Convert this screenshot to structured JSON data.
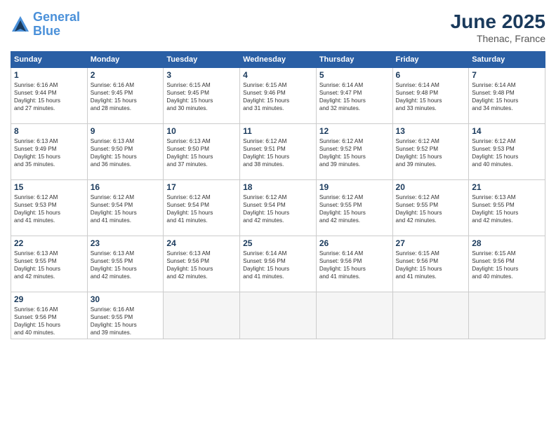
{
  "header": {
    "logo_line1": "General",
    "logo_line2": "Blue",
    "month": "June 2025",
    "location": "Thenac, France"
  },
  "weekdays": [
    "Sunday",
    "Monday",
    "Tuesday",
    "Wednesday",
    "Thursday",
    "Friday",
    "Saturday"
  ],
  "weeks": [
    [
      {
        "day": "1",
        "info": "Sunrise: 6:16 AM\nSunset: 9:44 PM\nDaylight: 15 hours\nand 27 minutes."
      },
      {
        "day": "2",
        "info": "Sunrise: 6:16 AM\nSunset: 9:45 PM\nDaylight: 15 hours\nand 28 minutes."
      },
      {
        "day": "3",
        "info": "Sunrise: 6:15 AM\nSunset: 9:45 PM\nDaylight: 15 hours\nand 30 minutes."
      },
      {
        "day": "4",
        "info": "Sunrise: 6:15 AM\nSunset: 9:46 PM\nDaylight: 15 hours\nand 31 minutes."
      },
      {
        "day": "5",
        "info": "Sunrise: 6:14 AM\nSunset: 9:47 PM\nDaylight: 15 hours\nand 32 minutes."
      },
      {
        "day": "6",
        "info": "Sunrise: 6:14 AM\nSunset: 9:48 PM\nDaylight: 15 hours\nand 33 minutes."
      },
      {
        "day": "7",
        "info": "Sunrise: 6:14 AM\nSunset: 9:48 PM\nDaylight: 15 hours\nand 34 minutes."
      }
    ],
    [
      {
        "day": "8",
        "info": "Sunrise: 6:13 AM\nSunset: 9:49 PM\nDaylight: 15 hours\nand 35 minutes."
      },
      {
        "day": "9",
        "info": "Sunrise: 6:13 AM\nSunset: 9:50 PM\nDaylight: 15 hours\nand 36 minutes."
      },
      {
        "day": "10",
        "info": "Sunrise: 6:13 AM\nSunset: 9:50 PM\nDaylight: 15 hours\nand 37 minutes."
      },
      {
        "day": "11",
        "info": "Sunrise: 6:12 AM\nSunset: 9:51 PM\nDaylight: 15 hours\nand 38 minutes."
      },
      {
        "day": "12",
        "info": "Sunrise: 6:12 AM\nSunset: 9:52 PM\nDaylight: 15 hours\nand 39 minutes."
      },
      {
        "day": "13",
        "info": "Sunrise: 6:12 AM\nSunset: 9:52 PM\nDaylight: 15 hours\nand 39 minutes."
      },
      {
        "day": "14",
        "info": "Sunrise: 6:12 AM\nSunset: 9:53 PM\nDaylight: 15 hours\nand 40 minutes."
      }
    ],
    [
      {
        "day": "15",
        "info": "Sunrise: 6:12 AM\nSunset: 9:53 PM\nDaylight: 15 hours\nand 41 minutes."
      },
      {
        "day": "16",
        "info": "Sunrise: 6:12 AM\nSunset: 9:54 PM\nDaylight: 15 hours\nand 41 minutes."
      },
      {
        "day": "17",
        "info": "Sunrise: 6:12 AM\nSunset: 9:54 PM\nDaylight: 15 hours\nand 41 minutes."
      },
      {
        "day": "18",
        "info": "Sunrise: 6:12 AM\nSunset: 9:54 PM\nDaylight: 15 hours\nand 42 minutes."
      },
      {
        "day": "19",
        "info": "Sunrise: 6:12 AM\nSunset: 9:55 PM\nDaylight: 15 hours\nand 42 minutes."
      },
      {
        "day": "20",
        "info": "Sunrise: 6:12 AM\nSunset: 9:55 PM\nDaylight: 15 hours\nand 42 minutes."
      },
      {
        "day": "21",
        "info": "Sunrise: 6:13 AM\nSunset: 9:55 PM\nDaylight: 15 hours\nand 42 minutes."
      }
    ],
    [
      {
        "day": "22",
        "info": "Sunrise: 6:13 AM\nSunset: 9:55 PM\nDaylight: 15 hours\nand 42 minutes."
      },
      {
        "day": "23",
        "info": "Sunrise: 6:13 AM\nSunset: 9:55 PM\nDaylight: 15 hours\nand 42 minutes."
      },
      {
        "day": "24",
        "info": "Sunrise: 6:13 AM\nSunset: 9:56 PM\nDaylight: 15 hours\nand 42 minutes."
      },
      {
        "day": "25",
        "info": "Sunrise: 6:14 AM\nSunset: 9:56 PM\nDaylight: 15 hours\nand 41 minutes."
      },
      {
        "day": "26",
        "info": "Sunrise: 6:14 AM\nSunset: 9:56 PM\nDaylight: 15 hours\nand 41 minutes."
      },
      {
        "day": "27",
        "info": "Sunrise: 6:15 AM\nSunset: 9:56 PM\nDaylight: 15 hours\nand 41 minutes."
      },
      {
        "day": "28",
        "info": "Sunrise: 6:15 AM\nSunset: 9:56 PM\nDaylight: 15 hours\nand 40 minutes."
      }
    ],
    [
      {
        "day": "29",
        "info": "Sunrise: 6:16 AM\nSunset: 9:56 PM\nDaylight: 15 hours\nand 40 minutes."
      },
      {
        "day": "30",
        "info": "Sunrise: 6:16 AM\nSunset: 9:55 PM\nDaylight: 15 hours\nand 39 minutes."
      },
      null,
      null,
      null,
      null,
      null
    ]
  ]
}
